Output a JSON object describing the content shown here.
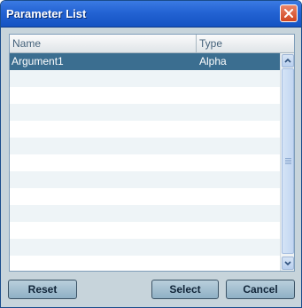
{
  "window": {
    "title": "Parameter List"
  },
  "table": {
    "columns": [
      "Name",
      "Type"
    ],
    "rows": [
      {
        "name": "Argument1",
        "type": "Alpha",
        "selected": true
      },
      {
        "name": "",
        "type": ""
      },
      {
        "name": "",
        "type": ""
      },
      {
        "name": "",
        "type": ""
      },
      {
        "name": "",
        "type": ""
      },
      {
        "name": "",
        "type": ""
      },
      {
        "name": "",
        "type": ""
      },
      {
        "name": "",
        "type": ""
      },
      {
        "name": "",
        "type": ""
      },
      {
        "name": "",
        "type": ""
      },
      {
        "name": "",
        "type": ""
      },
      {
        "name": "",
        "type": ""
      },
      {
        "name": "",
        "type": ""
      }
    ]
  },
  "buttons": {
    "reset": "Reset",
    "select": "Select",
    "cancel": "Cancel"
  },
  "icons": {
    "close": "close-icon",
    "scroll_up": "chevron-up-icon",
    "scroll_down": "chevron-down-icon"
  },
  "colors": {
    "titlebar": "#2363d3",
    "selection": "#3b6e90",
    "close": "#d0451f"
  }
}
